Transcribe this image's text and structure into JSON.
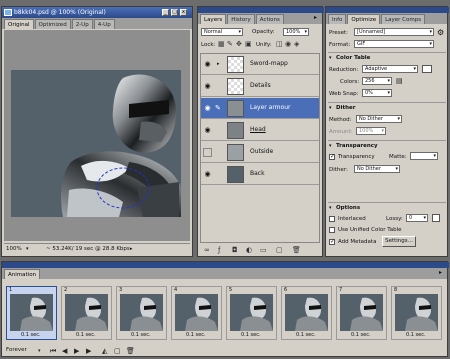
{
  "doc_window": {
    "title": "b8kk04.psd @ 100% (Original)",
    "tabs": [
      "Original",
      "Optimized",
      "2-Up",
      "4-Up"
    ],
    "zoom": "100%",
    "status": "~ 53.24K/ 19 sec @ 28.8 Kbps"
  },
  "layers_panel": {
    "tabs": [
      "Layers",
      "History",
      "Actions"
    ],
    "blend_mode": "Normal",
    "opacity_label": "Opacity:",
    "opacity_value": "100%",
    "lock_label": "Lock:",
    "unify_label": "Unify:",
    "fill_label": "Fill:",
    "fill_value": "100%",
    "layers": [
      {
        "name": "Sword-mapp",
        "visible": true,
        "active": false
      },
      {
        "name": "Details",
        "visible": true,
        "active": false
      },
      {
        "name": "Layer armour",
        "visible": true,
        "active": true
      },
      {
        "name": "Head",
        "visible": true,
        "active": false
      },
      {
        "name": "Outside",
        "visible": false,
        "active": false
      },
      {
        "name": "Back",
        "visible": true,
        "active": false
      }
    ]
  },
  "optimize_panel": {
    "tabs": [
      "Info",
      "Optimize",
      "Layer Comps"
    ],
    "preset_label": "Preset:",
    "preset_value": "[Unnamed]",
    "format_label": "Format:",
    "format_value": "GIF",
    "color_table_label": "Color Table",
    "reduction_label": "Reduction:",
    "reduction_value": "Adaptive",
    "colors_label": "Colors:",
    "colors_value": "256",
    "web_snap_label": "Web Snap:",
    "web_snap_value": "0%",
    "dither_label": "Dither",
    "dither_method_label": "Method:",
    "dither_method_value": "No Dither",
    "dither_amount_label": "Amount:",
    "dither_amount_value": "100%",
    "transparency_section": "Transparency",
    "transparency_check": "Transparency",
    "matte_label": "Matte:",
    "matte_value": "",
    "trans_dither_label": "Dither:",
    "trans_dither_value": "No Dither",
    "options_label": "Options",
    "interlaced_label": "Interlaced",
    "lossy_label": "Lossy:",
    "lossy_value": "0",
    "unified_label": "Use Unified Color Table",
    "metadata_label": "Add Metadata",
    "settings_button": "Settings..."
  },
  "animation_panel": {
    "tab": "Animation",
    "loop_value": "Forever",
    "frames": [
      {
        "num": "1",
        "time": "0.1 sec."
      },
      {
        "num": "2",
        "time": "0.1 sec."
      },
      {
        "num": "3",
        "time": "0.1 sec."
      },
      {
        "num": "4",
        "time": "0.1 sec."
      },
      {
        "num": "5",
        "time": "0.1 sec."
      },
      {
        "num": "6",
        "time": "0.1 sec."
      },
      {
        "num": "7",
        "time": "0.1 sec."
      },
      {
        "num": "8",
        "time": "0.1 sec."
      }
    ]
  },
  "colors": {
    "accent": "#2c4a8a",
    "panel": "#d4d0c8",
    "canvas_bg": "#55616a"
  }
}
